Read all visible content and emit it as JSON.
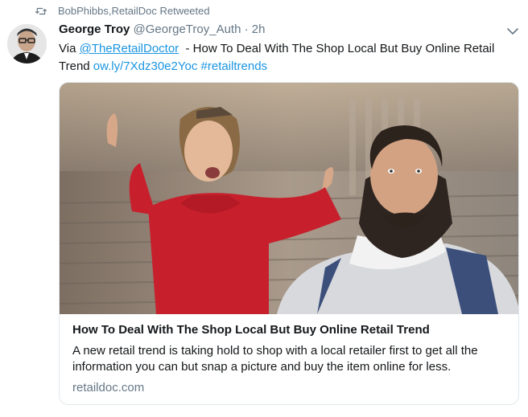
{
  "retweet": {
    "icon": "retweet-icon",
    "label": "BobPhibbs,RetailDoc Retweeted"
  },
  "tweet": {
    "avatar": "avatar",
    "author_name": "George Troy",
    "author_handle": "@GeorgeTroy_Auth",
    "separator": "·",
    "time": "2h",
    "menu_icon": "chevron-down-icon",
    "text_prefix": "Via ",
    "mention": "@TheRetailDoctor",
    "text_middle": "  - How To Deal With The Shop Local But Buy Online Retail Trend ",
    "url": "ow.ly/7Xdz30e2Yoc",
    "hashtag": "#retailtrends"
  },
  "card": {
    "title": "How To Deal With The Shop Local But Buy Online Retail Trend",
    "description": "A new retail trend is taking hold to shop with a local retailer first to get all the information you can but snap a picture and buy the item online for less.",
    "domain": "retaildoc.com"
  },
  "colors": {
    "link": "#1b95e0",
    "muted": "#657786",
    "text": "#14171a",
    "border": "#e1e8ed"
  }
}
